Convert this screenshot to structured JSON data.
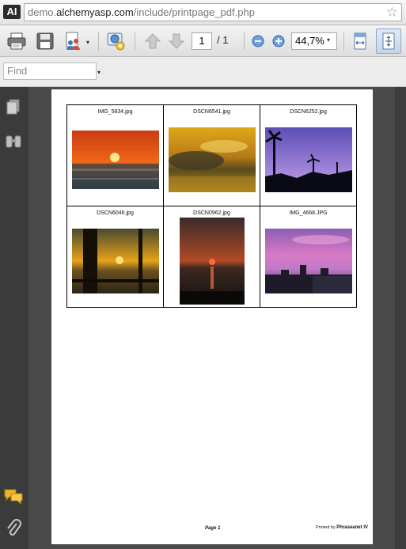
{
  "browser": {
    "favicon_text": "AI",
    "url_prefix": "demo.",
    "url_host": "alchemyasp.com",
    "url_path": "/include/printpage_pdf.php"
  },
  "toolbar": {
    "current_page": "1",
    "page_total": "/ 1",
    "zoom": "44,7%"
  },
  "findbar": {
    "placeholder": "Find"
  },
  "document": {
    "photos": [
      {
        "caption": "IMG_5834.jpg"
      },
      {
        "caption": "DSCN6541.jpg"
      },
      {
        "caption": "DSCN6252.jpg"
      },
      {
        "caption": "DSCN6046.jpg"
      },
      {
        "caption": "DSCN0962.jpg"
      },
      {
        "caption": "IMG_4668.JPG"
      }
    ],
    "footer_page": "Page 1",
    "footer_printed_prefix": "Printed by",
    "footer_printed_brand": "Phraseanet IV"
  }
}
